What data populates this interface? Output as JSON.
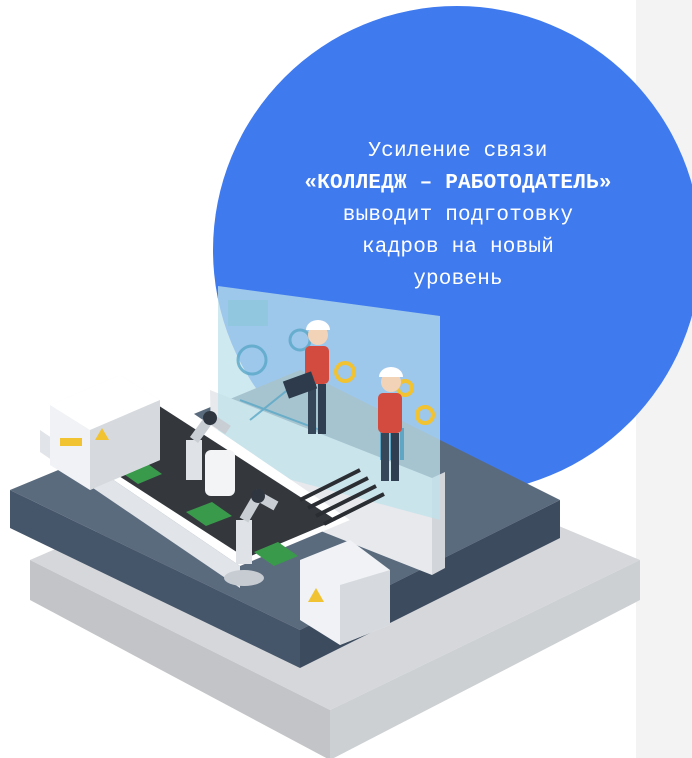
{
  "banner": {
    "headline_line1": "Усиление связи",
    "headline_bold": "«КОЛЛЕДЖ – РАБОТОДАТЕЛЬ»",
    "headline_rest_1": "выводит подготовку",
    "headline_rest_2": "кадров на новый",
    "headline_rest_3": "уровень"
  },
  "colors": {
    "circle": "#3f7aef",
    "platform": "#5b6b7e",
    "floor_shadow": "#b7b9bc",
    "machine": "#eceef1",
    "screen": "#c3e2ec",
    "workers_shirt": "#d24b3e"
  }
}
